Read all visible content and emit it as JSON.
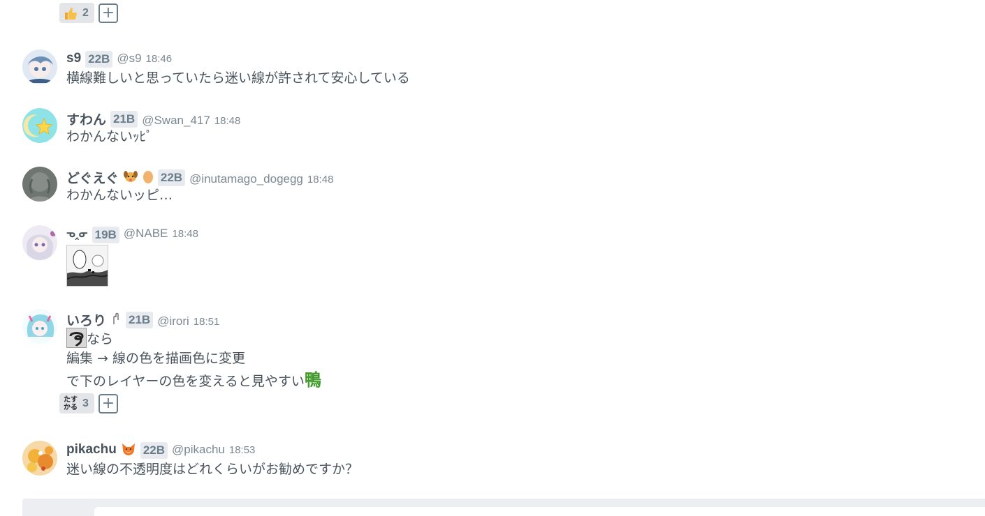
{
  "top_reactions": {
    "reaction_count": "2",
    "add_label": "+"
  },
  "messages": [
    {
      "name": "s9",
      "grade": "22B",
      "handle": "@s9",
      "time": "18:46",
      "lines": [
        "横線難しいと思っていたら迷い線が許されて安心している"
      ]
    },
    {
      "name": "すわん",
      "grade": "21B",
      "handle": "@Swan_417",
      "time": "18:48",
      "lines": [
        "わかんないｯﾋﾟ"
      ]
    },
    {
      "name": "どぐえぐ",
      "grade": "22B",
      "handle": "@inutamago_dogegg",
      "time": "18:48",
      "lines": [
        "わかんないッピ…"
      ]
    },
    {
      "name": "ᓀ‸ᓂ",
      "grade": "19B",
      "handle": "@NABE",
      "time": "18:48",
      "lines": []
    },
    {
      "name": "いろり",
      "grade": "21B",
      "handle": "@irori",
      "time": "18:51",
      "lines": [
        "なら",
        "編集 → 線の色を描画色に変更",
        "で下のレイヤーの色を変えると見やすい"
      ],
      "stamp_text": "鴨",
      "reaction_count": "3",
      "reaction_stamp": "たす\nかる",
      "add_label": "+"
    },
    {
      "name": "pikachu",
      "grade": "22B",
      "handle": "@pikachu",
      "time": "18:53",
      "lines": [
        "迷い線の不透明度はどれくらいがお勧めですか？"
      ]
    }
  ]
}
